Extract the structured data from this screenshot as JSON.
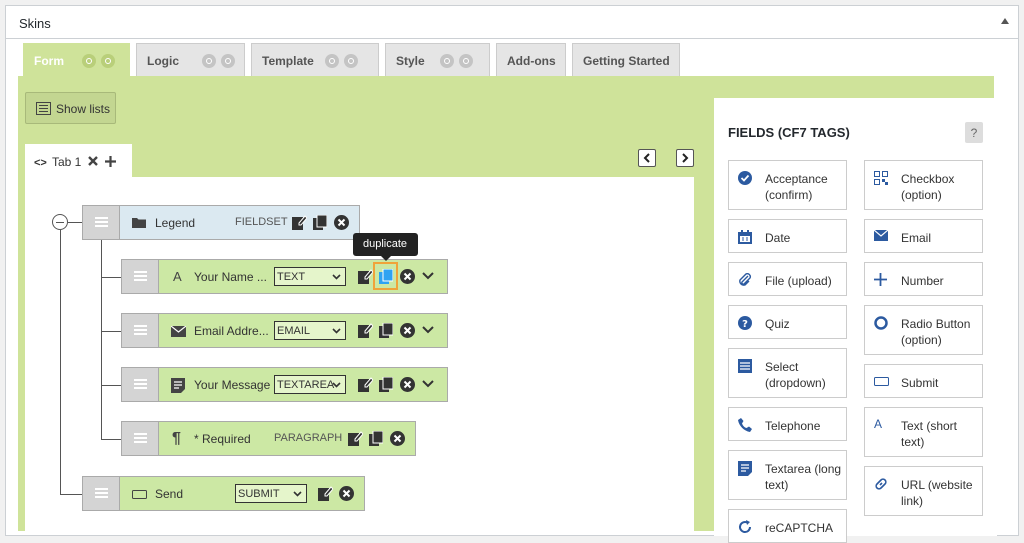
{
  "panel": {
    "title": "Skins"
  },
  "tabs": [
    {
      "label": "Form",
      "active": true,
      "icons": true
    },
    {
      "label": "Logic",
      "icons": true
    },
    {
      "label": "Template",
      "icons": true
    },
    {
      "label": "Style",
      "icons": true
    },
    {
      "label": "Add-ons",
      "icons": false
    },
    {
      "label": "Getting Started",
      "icons": false
    }
  ],
  "toolbar": {
    "show_lists_label": "Show lists"
  },
  "form_tabs": {
    "code_icon": "<>",
    "tab_label": "Tab 1"
  },
  "form_rows": [
    {
      "label": "Legend",
      "type": "FIELDSET",
      "icon": "folder-icon"
    },
    {
      "label": "Your Name ...",
      "select": "TEXT",
      "icon": "text-a-icon"
    },
    {
      "label": "Email Addre...",
      "select": "EMAIL",
      "icon": "envelope-icon"
    },
    {
      "label": "Your Message",
      "select": "TEXTAREA",
      "icon": "textarea-icon"
    },
    {
      "label": "* Required",
      "type": "PARAGRAPH",
      "icon": "pilcrow-icon"
    },
    {
      "label": "Send",
      "select": "SUBMIT",
      "icon": "button-icon"
    }
  ],
  "tooltip": {
    "text": "duplicate"
  },
  "fields_panel": {
    "title": "FIELDS (CF7 TAGS)",
    "help": "?",
    "items": [
      {
        "label": "Acceptance (confirm)",
        "icon": "check-circle-icon"
      },
      {
        "label": "Checkbox (option)",
        "icon": "qr-checkbox-icon"
      },
      {
        "label": "Date",
        "icon": "calendar-icon"
      },
      {
        "label": "Email",
        "icon": "envelope-icon"
      },
      {
        "label": "File (upload)",
        "icon": "paperclip-icon"
      },
      {
        "label": "Number",
        "icon": "plus-icon"
      },
      {
        "label": "Quiz",
        "icon": "question-circle-icon"
      },
      {
        "label": "Radio Button (option)",
        "icon": "radio-icon"
      },
      {
        "label": "Select (dropdown)",
        "icon": "list-icon"
      },
      {
        "label": "Submit",
        "icon": "button-icon"
      },
      {
        "label": "Telephone",
        "icon": "phone-icon"
      },
      {
        "label": "Text (short text)",
        "icon": "text-a-icon"
      },
      {
        "label": "Textarea (long text)",
        "icon": "textarea-icon"
      },
      {
        "label": "URL (website link)",
        "icon": "link-icon"
      },
      {
        "label": "reCAPTCHA",
        "icon": "refresh-icon"
      }
    ]
  },
  "colors": {
    "accent_green": "#cfe39a",
    "row_green": "#cce8a4",
    "fieldset_blue": "#dbe9f1",
    "highlight": "#f0a33a"
  }
}
